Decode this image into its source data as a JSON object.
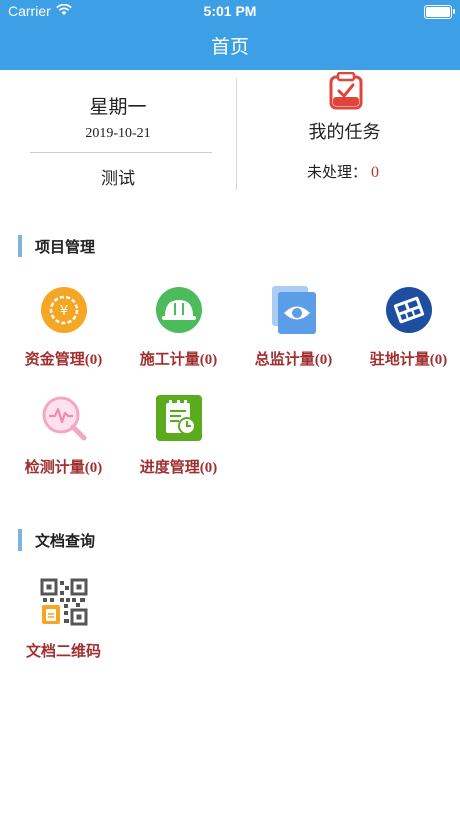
{
  "status_bar": {
    "carrier": "Carrier",
    "time": "5:01 PM"
  },
  "nav": {
    "title": "首页"
  },
  "summary": {
    "weekday": "星期一",
    "date": "2019-10-21",
    "user": "测试",
    "task_title": "我的任务",
    "pending_label": "未处理：",
    "pending_count": "0"
  },
  "sections": {
    "project": {
      "title": "项目管理",
      "items": [
        {
          "label": "资金管理",
          "count": "(0)",
          "icon": "yuan-gear-icon",
          "color": "#f5a623"
        },
        {
          "label": "施工计量",
          "count": "(0)",
          "icon": "hard-hat-icon",
          "color": "#4cbb5c"
        },
        {
          "label": "总监计量",
          "count": "(0)",
          "icon": "eye-document-icon",
          "color": "#5b9de6"
        },
        {
          "label": "驻地计量",
          "count": "(0)",
          "icon": "building-blocks-icon",
          "color": "#1d4ea0"
        },
        {
          "label": "检测计量",
          "count": "(0)",
          "icon": "pulse-magnifier-icon",
          "color": "#f4a7c3"
        },
        {
          "label": "进度管理",
          "count": "(0)",
          "icon": "schedule-clipboard-icon",
          "color": "#5aab1e"
        }
      ]
    },
    "documents": {
      "title": "文档查询",
      "items": [
        {
          "label": "文档二维码",
          "icon": "qr-code-document-icon",
          "color": "#f5a623"
        }
      ]
    }
  }
}
